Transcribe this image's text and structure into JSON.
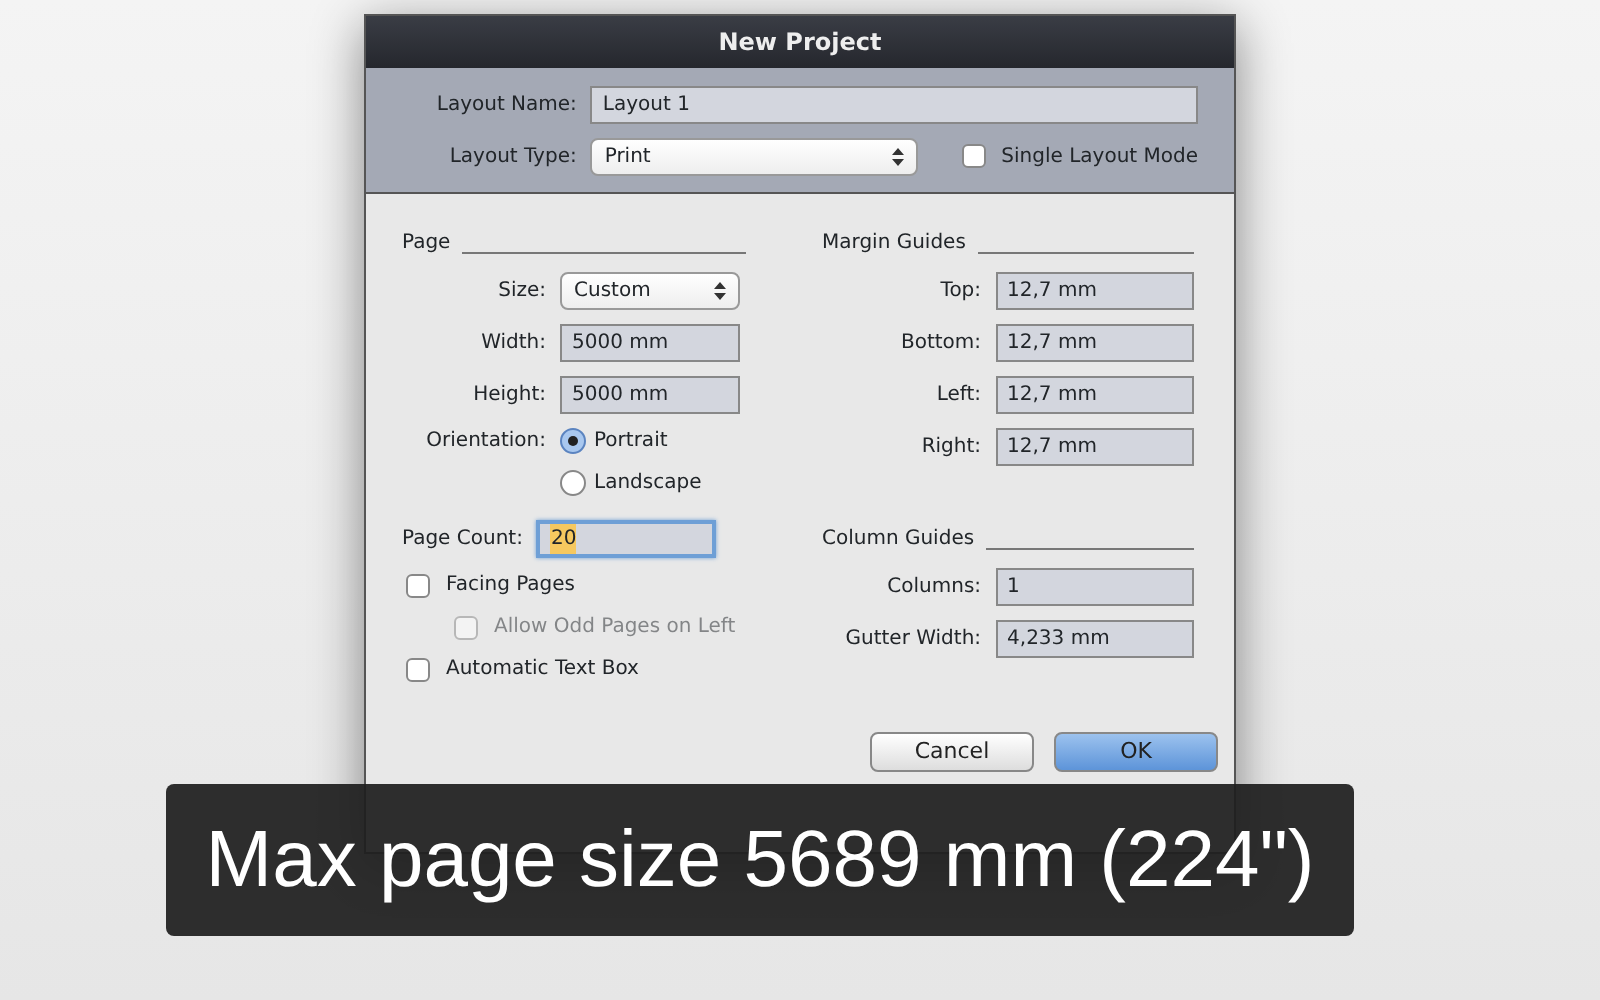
{
  "window": {
    "title": "New Project"
  },
  "layout": {
    "name_label": "Layout Name:",
    "name_value": "Layout 1",
    "type_label": "Layout Type:",
    "type_value": "Print",
    "single_mode": {
      "label": "Single Layout Mode",
      "checked": false
    }
  },
  "page": {
    "heading": "Page",
    "fields": [
      {
        "kind": "select",
        "label": "Size:",
        "value": "Custom"
      },
      {
        "kind": "text",
        "label": "Width:",
        "value": "5000 mm"
      },
      {
        "kind": "text",
        "label": "Height:",
        "value": "5000 mm"
      }
    ],
    "orientation": {
      "label": "Orientation:",
      "options": [
        {
          "label": "Portrait",
          "selected": true
        },
        {
          "label": "Landscape",
          "selected": false
        }
      ]
    },
    "page_count": {
      "label": "Page Count:",
      "value": "20",
      "focused": true
    },
    "checkboxes": [
      {
        "label": "Facing Pages",
        "checked": false,
        "disabled": false,
        "children": [
          {
            "label": "Allow Odd Pages on Left",
            "checked": false,
            "disabled": true
          }
        ]
      },
      {
        "label": "Automatic Text Box",
        "checked": false,
        "disabled": false
      }
    ]
  },
  "margin_guides": {
    "heading": "Margin Guides",
    "fields": [
      {
        "kind": "text",
        "label": "Top:",
        "value": "12,7 mm"
      },
      {
        "kind": "text",
        "label": "Bottom:",
        "value": "12,7 mm"
      },
      {
        "kind": "text",
        "label": "Left:",
        "value": "12,7 mm"
      },
      {
        "kind": "text",
        "label": "Right:",
        "value": "12,7 mm"
      }
    ]
  },
  "column_guides": {
    "heading": "Column Guides",
    "fields": [
      {
        "kind": "text",
        "label": "Columns:",
        "value": "1"
      },
      {
        "kind": "text",
        "label": "Gutter Width:",
        "value": "4,233 mm"
      }
    ]
  },
  "buttons": [
    {
      "label": "Cancel",
      "primary": false
    },
    {
      "label": "OK",
      "primary": true
    }
  ],
  "caption": "Max page size 5689 mm (224\")"
}
